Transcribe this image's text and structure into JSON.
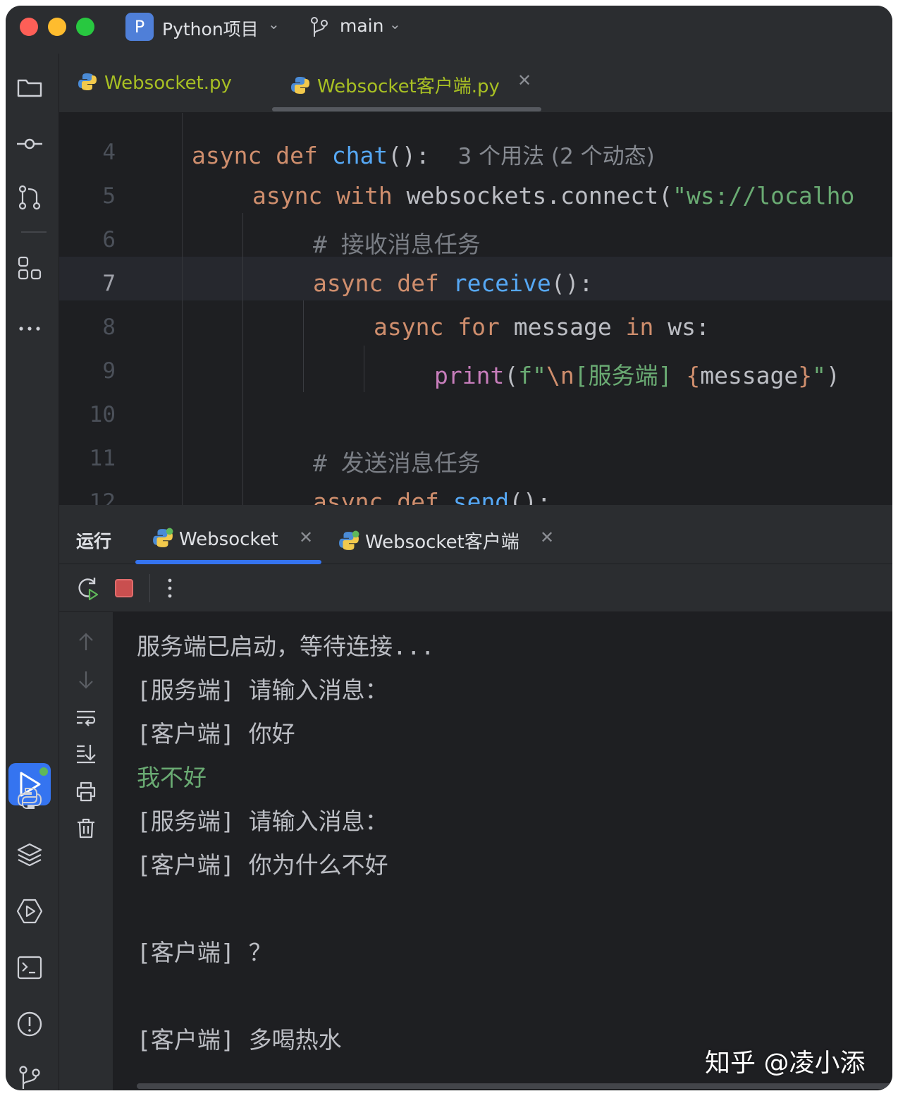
{
  "titlebar": {
    "project_badge": "P",
    "project_name": "Python项目",
    "branch": "main"
  },
  "editor_tabs": [
    {
      "label": "Websocket.py",
      "active": false
    },
    {
      "label": "Websocket客户端.py",
      "active": true
    }
  ],
  "editor": {
    "line_numbers": [
      "4",
      "5",
      "6",
      "7",
      "8",
      "9",
      "10",
      "11",
      "12"
    ],
    "current_line": "7",
    "usage_hint": "3 个用法 (2 个动态)",
    "lines": {
      "l4": {
        "kw1": "async",
        "kw2": "def",
        "fn": "chat",
        "rest": "():"
      },
      "l5": {
        "kw1": "async",
        "kw2": "with",
        "rest": "websockets.connect(",
        "str": "\"ws://localho"
      },
      "l6": {
        "comment": "# 接收消息任务"
      },
      "l7": {
        "kw1": "async",
        "kw2": "def",
        "fn": "receive",
        "rest": "():"
      },
      "l8": {
        "kw1": "async",
        "kw2": "for",
        "mid": "message",
        "kw3": "in",
        "rest": "ws:"
      },
      "l9": {
        "builtin": "print",
        "p1": "(",
        "str1": "f\"",
        "esc": "\\n",
        "str2": "[服务端] ",
        "b1": "{",
        "var": "message",
        "b2": "}",
        "str3": "\"",
        "p2": ")"
      },
      "l11": {
        "comment": "# 发送消息任务"
      },
      "l12": {
        "kw1": "async",
        "kw2": "def",
        "fn": "send",
        "rest": "():"
      }
    }
  },
  "run_panel": {
    "title": "运行",
    "tabs": [
      {
        "label": "Websocket",
        "active": true
      },
      {
        "label": "Websocket客户端",
        "active": false
      }
    ]
  },
  "console": {
    "lines": [
      {
        "text": "服务端已启动，等待连接...",
        "color": "default"
      },
      {
        "text": "[服务端] 请输入消息：",
        "color": "default"
      },
      {
        "text": "[客户端] 你好",
        "color": "default"
      },
      {
        "text": "我不好",
        "color": "green"
      },
      {
        "text": "[服务端] 请输入消息：",
        "color": "default"
      },
      {
        "text": "[客户端] 你为什么不好",
        "color": "default"
      },
      {
        "text": "",
        "color": "default"
      },
      {
        "text": "[客户端] ？",
        "color": "default"
      },
      {
        "text": "",
        "color": "default"
      },
      {
        "text": "[客户端] 多喝热水",
        "color": "default"
      }
    ]
  },
  "watermark": "知乎 @凌小添",
  "colors": {
    "background": "#1e1f22",
    "panel": "#2b2d30",
    "accent": "#3574f0",
    "keyword": "#cf8e6d",
    "function": "#56a8f5",
    "string": "#6aab73",
    "comment": "#7a7e85"
  }
}
